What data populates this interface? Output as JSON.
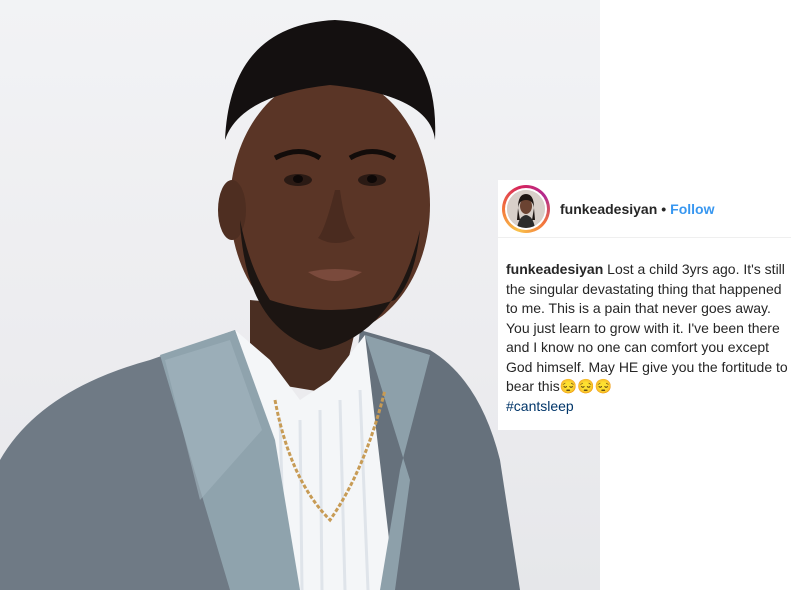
{
  "post": {
    "username": "funkeadesiyan",
    "separator": "•",
    "follow_label": "Follow",
    "caption_username": "funkeadesiyan",
    "caption_text": "Lost a child 3yrs ago. It's still the singular devastating thing that happened to me. This is a pain that never goes away. You just learn to grow with it. I've been there and I know no one can comfort you except God himself. May HE give you the fortitude to bear this😔😔😔",
    "hashtag": "#cantsleep"
  },
  "colors": {
    "follow": "#3897f0",
    "hashtag": "#003569",
    "text": "#262626",
    "jacket": "#6f7a85",
    "lapel": "#8fa3ad"
  },
  "icons": {
    "avatar": "profile-photo-avatar"
  }
}
